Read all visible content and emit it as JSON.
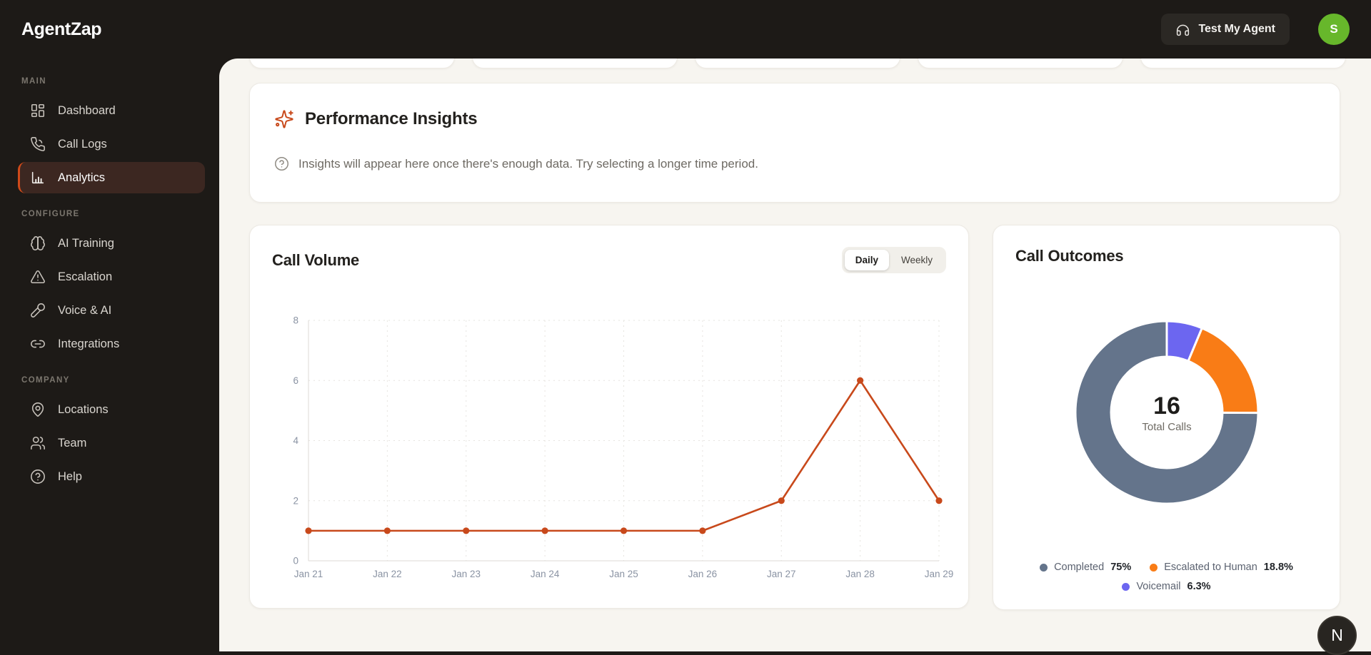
{
  "app": {
    "name": "AgentZap"
  },
  "topbar": {
    "test_agent_button": "Test My Agent",
    "avatar_initial": "S"
  },
  "floating_badge": {
    "label": "N"
  },
  "sidebar": {
    "sections": [
      {
        "label": "MAIN",
        "items": [
          {
            "id": "dashboard",
            "icon": "dashboard-icon",
            "label": "Dashboard",
            "active": false
          },
          {
            "id": "call-logs",
            "icon": "phone-icon",
            "label": "Call Logs",
            "active": false
          },
          {
            "id": "analytics",
            "icon": "bar-chart-icon",
            "label": "Analytics",
            "active": true
          }
        ]
      },
      {
        "label": "CONFIGURE",
        "items": [
          {
            "id": "ai-training",
            "icon": "brain-icon",
            "label": "AI Training",
            "active": false
          },
          {
            "id": "escalation",
            "icon": "warning-triangle-icon",
            "label": "Escalation",
            "active": false
          },
          {
            "id": "voice-ai",
            "icon": "microphone-icon",
            "label": "Voice & AI",
            "active": false
          },
          {
            "id": "integrations",
            "icon": "link-icon",
            "label": "Integrations",
            "active": false
          }
        ]
      },
      {
        "label": "COMPANY",
        "items": [
          {
            "id": "locations",
            "icon": "map-pin-icon",
            "label": "Locations",
            "active": false
          },
          {
            "id": "team",
            "icon": "users-icon",
            "label": "Team",
            "active": false
          },
          {
            "id": "help",
            "icon": "help-circle-icon",
            "label": "Help",
            "active": false
          }
        ]
      }
    ]
  },
  "main": {
    "cutoff_card_count": 5,
    "insights": {
      "title": "Performance Insights",
      "message": "Insights will appear here once there's enough data. Try selecting a longer time period."
    },
    "call_volume": {
      "title": "Call Volume",
      "toggles": [
        "Daily",
        "Weekly"
      ],
      "active_toggle": "Daily"
    },
    "call_outcomes": {
      "title": "Call Outcomes"
    }
  },
  "colors": {
    "accent_orange": "#c8491b",
    "sidebar_active_bg": "#3c2721",
    "avatar_green": "#67b72b",
    "donut_completed": "#64748b",
    "donut_escalated": "#f97c16",
    "donut_voicemail": "#6c66f0",
    "axis_label_gray": "#8a93a3"
  },
  "chart_data": [
    {
      "type": "line",
      "title": "Call Volume",
      "x": [
        "Jan 21",
        "Jan 22",
        "Jan 23",
        "Jan 24",
        "Jan 25",
        "Jan 26",
        "Jan 27",
        "Jan 28",
        "Jan 29"
      ],
      "values": [
        1,
        1,
        1,
        1,
        1,
        1,
        2,
        6,
        2
      ],
      "xlabel": "",
      "ylabel": "",
      "ylim": [
        0,
        8
      ],
      "yticks": [
        0,
        2,
        4,
        6,
        8
      ],
      "grid": true,
      "legend_position": "none",
      "line_color": "#c8491b"
    },
    {
      "type": "donut",
      "title": "Call Outcomes",
      "center_value": "16",
      "center_label": "Total Calls",
      "start_angle_deg": -90,
      "clockwise": true,
      "slices_draw_order": [
        {
          "label": "Voicemail",
          "pct": 6.3,
          "color": "#6c66f0"
        },
        {
          "label": "Escalated to Human",
          "pct": 18.8,
          "color": "#f97c16"
        },
        {
          "label": "Completed",
          "pct": 75,
          "color": "#64748b"
        }
      ],
      "legend": [
        {
          "label": "Completed",
          "value": "75%",
          "color": "#64748b"
        },
        {
          "label": "Escalated to Human",
          "value": "18.8%",
          "color": "#f97c16"
        },
        {
          "label": "Voicemail",
          "value": "6.3%",
          "color": "#6c66f0"
        }
      ]
    }
  ]
}
